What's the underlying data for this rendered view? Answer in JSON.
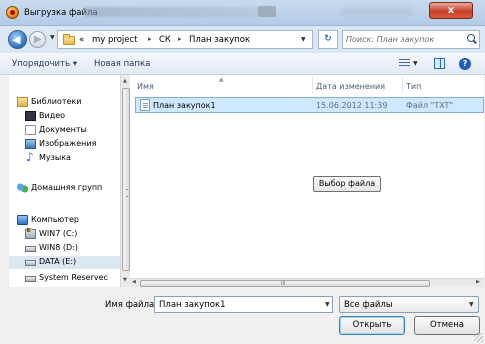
{
  "window": {
    "title": "Выгрузка файла",
    "close_label": "x"
  },
  "address": {
    "back_glyph": "◀",
    "forward_glyph": "▶",
    "overflow": "«",
    "breadcrumb": [
      "my project",
      "СК",
      "План закупок"
    ],
    "separator": "▸",
    "refresh_glyph": "↻",
    "search_placeholder": "Поиск: План закупок"
  },
  "toolbar": {
    "organize_label": "Упорядочить ▾",
    "new_folder_label": "Новая папка",
    "help_label": "?"
  },
  "nav": {
    "items": [
      {
        "label": "Библиотеки",
        "icon": "library-icon"
      },
      {
        "label": "Видео",
        "icon": "video-icon"
      },
      {
        "label": "Документы",
        "icon": "documents-icon"
      },
      {
        "label": "Изображения",
        "icon": "images-icon"
      },
      {
        "label": "Музыка",
        "icon": "music-icon"
      },
      {
        "label": "Домашняя групп",
        "icon": "homegroup-icon"
      },
      {
        "label": "Компьютер",
        "icon": "computer-icon"
      },
      {
        "label": "WIN7 (C:)",
        "icon": "drive-win-icon"
      },
      {
        "label": "WIN8 (D:)",
        "icon": "drive-icon"
      },
      {
        "label": "DATA (E:)",
        "icon": "drive-icon",
        "selected": true
      },
      {
        "label": "System Reservec",
        "icon": "drive-icon"
      }
    ]
  },
  "files": {
    "columns": {
      "name": "Имя",
      "date": "Дата изменения",
      "type": "Тип"
    },
    "rows": [
      {
        "name": "План закупок1",
        "date": "15.06.2012 11:39",
        "type": "Файл \"TXT\""
      }
    ],
    "select_button": "Выбор файла"
  },
  "footer": {
    "filename_label": "Имя файла:",
    "filename_value": "План закупок1",
    "filter_value": "Все файлы",
    "open_label": "Открыть",
    "cancel_label": "Отмена"
  },
  "scroll": {
    "up": "▲",
    "down": "▼",
    "left": "◀",
    "right": "▶",
    "grip": "III"
  },
  "colors": {
    "selection": "#cde8ff",
    "selection_border": "#84acdd",
    "close": "#c8412a"
  }
}
